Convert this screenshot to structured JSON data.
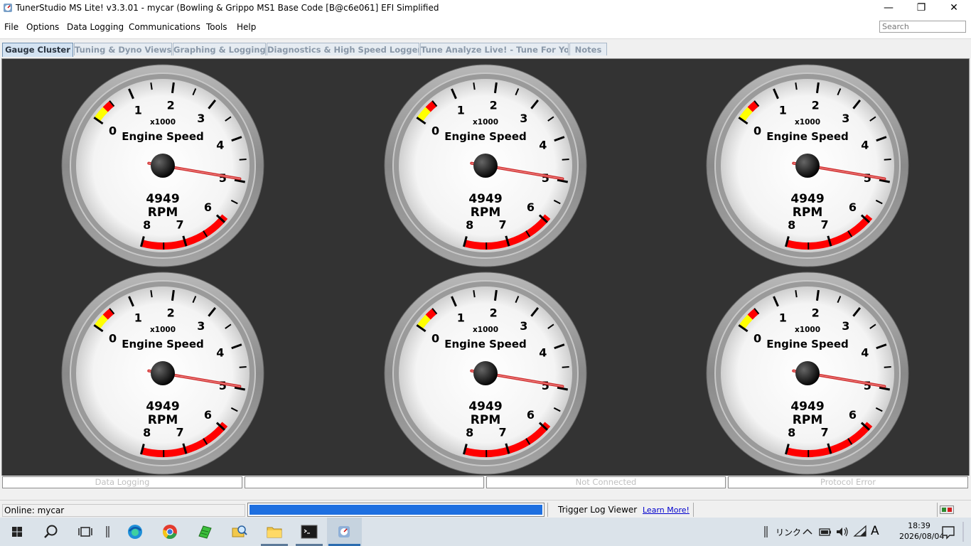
{
  "window": {
    "title": "TunerStudio MS Lite! v3.3.01 - mycar (Bowling & Grippo MS1 Base Code [B@c6e061] EFI Simplified",
    "minimize_glyph": "—",
    "maximize_glyph": "❐",
    "close_glyph": "✕"
  },
  "menu": {
    "items": [
      "File",
      "Options",
      "Data Logging",
      "Communications",
      "Tools",
      "Help"
    ],
    "search_placeholder": "Search"
  },
  "tabs": [
    "Gauge Cluster",
    "Tuning & Dyno Views",
    "Graphing & Logging",
    "Diagnostics & High Speed Loggers",
    "Tune Analyze Live! - Tune For You",
    "Notes"
  ],
  "active_tab": "Gauge Cluster",
  "gauge": {
    "title": "Engine Speed",
    "multiplier": "x1000",
    "value": "4949",
    "units": "RPM",
    "value_numeric": 4949,
    "min": 0,
    "max": 8,
    "scale": 1000,
    "tick_labels": [
      "0",
      "1",
      "2",
      "3",
      "4",
      "5",
      "6",
      "7",
      "8"
    ],
    "low_warning_range": [
      0,
      0.3
    ],
    "low_danger_range": [
      0.3,
      0.5
    ],
    "high_danger_range": [
      5.9,
      8
    ],
    "warning_color": "#ffff00",
    "danger_color": "#ff0000",
    "needle_color": "#d03030",
    "count": 6
  },
  "status_boxes": [
    "Data Logging",
    "",
    "Not Connected",
    "Protocol Error"
  ],
  "status_bar": {
    "online": "Online: mycar",
    "progress": 1.0,
    "trigger_log_viewer": "Trigger Log Viewer",
    "learn_more": "Learn More!"
  },
  "taskbar": {
    "ime_label": "リンク",
    "input_mode": "A",
    "time": "18:39",
    "date": "2026/08/04"
  },
  "colors": {
    "panel_background": "#333333",
    "progress_fill": "#1e6fe0",
    "link": "#0000cc"
  }
}
